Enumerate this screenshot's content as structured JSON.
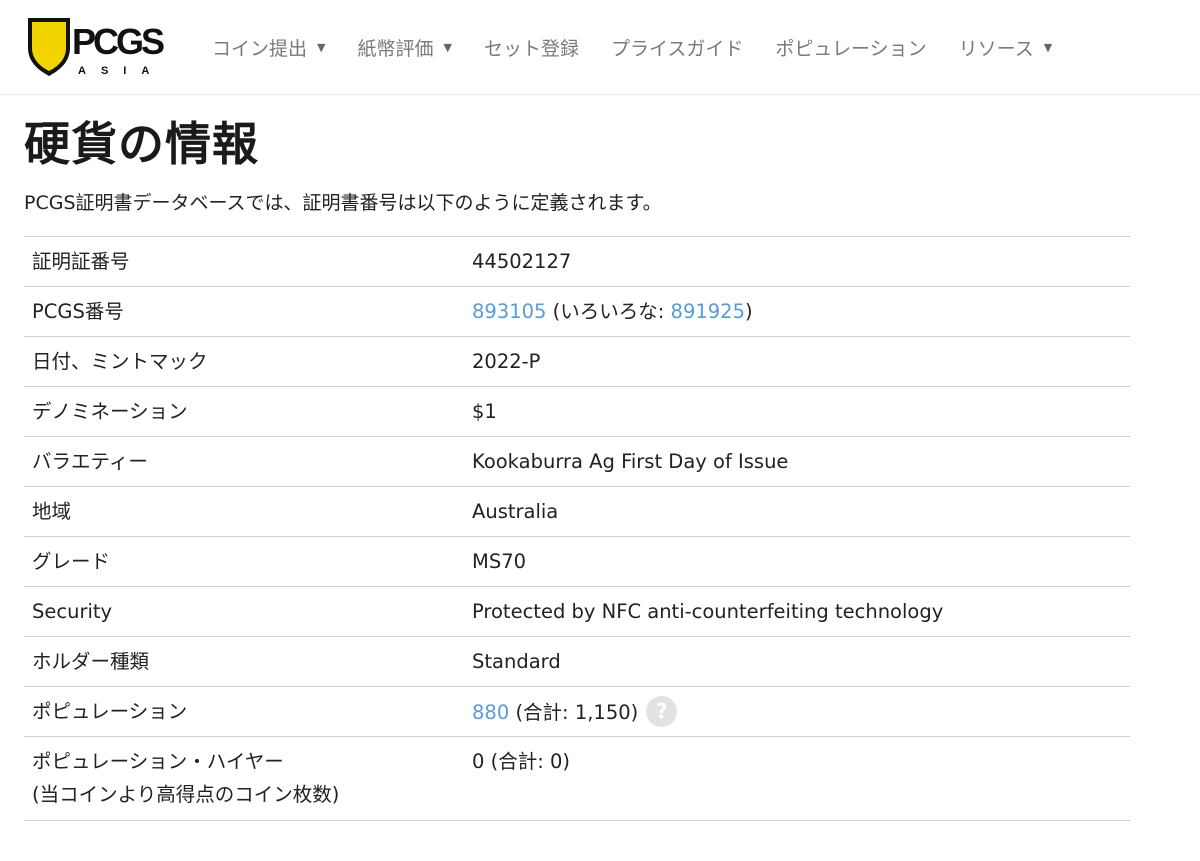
{
  "brand": {
    "logo_text": "PCGS",
    "logo_sub": "ASIA"
  },
  "nav": [
    {
      "label": "コイン提出",
      "has_dropdown": true
    },
    {
      "label": "紙幣評価",
      "has_dropdown": true
    },
    {
      "label": "セット登録",
      "has_dropdown": false
    },
    {
      "label": "プライスガイド",
      "has_dropdown": false
    },
    {
      "label": "ポピュレーション",
      "has_dropdown": false
    },
    {
      "label": "リソース",
      "has_dropdown": true
    }
  ],
  "dropdown_glyph": "▼",
  "page": {
    "title": "硬貨の情報",
    "intro": "PCGS証明書データベースでは、証明書番号は以下のように定義されます。"
  },
  "details": {
    "cert": {
      "label": "証明証番号",
      "value": "44502127"
    },
    "pcgs": {
      "label": "PCGS番号",
      "number": "893105",
      "variety_prefix": "(いろいろな: ",
      "variety_number": "891925",
      "variety_suffix": ")"
    },
    "date": {
      "label": "日付、ミントマック",
      "value": "2022-P"
    },
    "denomination": {
      "label": "デノミネーション",
      "value": "$1"
    },
    "variety": {
      "label": "バラエティー",
      "value": "Kookaburra Ag First Day of Issue"
    },
    "region": {
      "label": "地域",
      "value": "Australia"
    },
    "grade": {
      "label": "グレード",
      "value": "MS70"
    },
    "security": {
      "label": "Security",
      "value": "Protected by NFC anti-counterfeiting technology"
    },
    "holder": {
      "label": "ホルダー種類",
      "value": "Standard"
    },
    "population": {
      "label": "ポピュレーション",
      "number": "880",
      "total": "(合計: 1,150)",
      "help_glyph": "?"
    },
    "pop_higher": {
      "label_line1": "ポピュレーション・ハイヤー",
      "label_line2": "(当コインより高得点のコイン枚数)",
      "value": "0",
      "total": "(合計: 0)"
    }
  },
  "colors": {
    "link": "#5b9bd5",
    "shield": "#f2d500",
    "logo_gold": "#c9a227"
  }
}
